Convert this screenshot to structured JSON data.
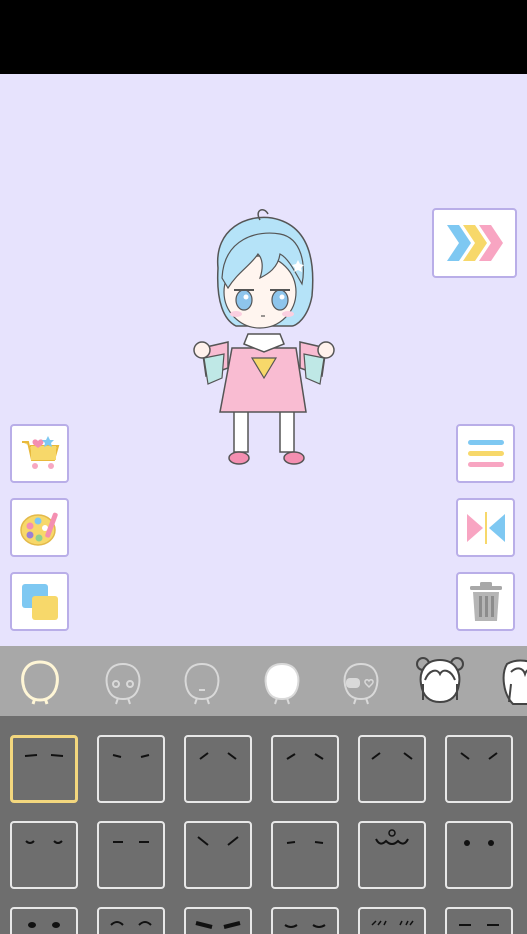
{
  "stage": {
    "background": "#e7e3fd"
  },
  "left_buttons": [
    {
      "name": "shop-cart-button",
      "icon": "shopping-cart-icon"
    },
    {
      "name": "color-palette-button",
      "icon": "palette-icon"
    },
    {
      "name": "background-button",
      "icon": "layers-icon"
    }
  ],
  "right_buttons": [
    {
      "name": "next-arrows-button",
      "icon": "triple-chevron-icon"
    },
    {
      "name": "menu-button",
      "icon": "menu-lines-icon"
    },
    {
      "name": "flip-button",
      "icon": "flip-horizontal-icon"
    },
    {
      "name": "delete-button",
      "icon": "trash-icon"
    }
  ],
  "categories": [
    {
      "name": "category-head-outline",
      "selected": true
    },
    {
      "name": "category-face-eyes",
      "selected": false
    },
    {
      "name": "category-face-mouth",
      "selected": false
    },
    {
      "name": "category-face-blank",
      "selected": false
    },
    {
      "name": "category-face-accessory",
      "selected": false
    },
    {
      "name": "category-hair-bear",
      "selected": false
    },
    {
      "name": "category-hair-side",
      "selected": false
    }
  ],
  "tiles": {
    "selected_index": 0,
    "count": 18
  },
  "colors": {
    "accent_pink": "#f8a5c2",
    "accent_blue": "#7ec8f2",
    "accent_yellow": "#f7d86a",
    "selected_border": "#f3d77e"
  }
}
